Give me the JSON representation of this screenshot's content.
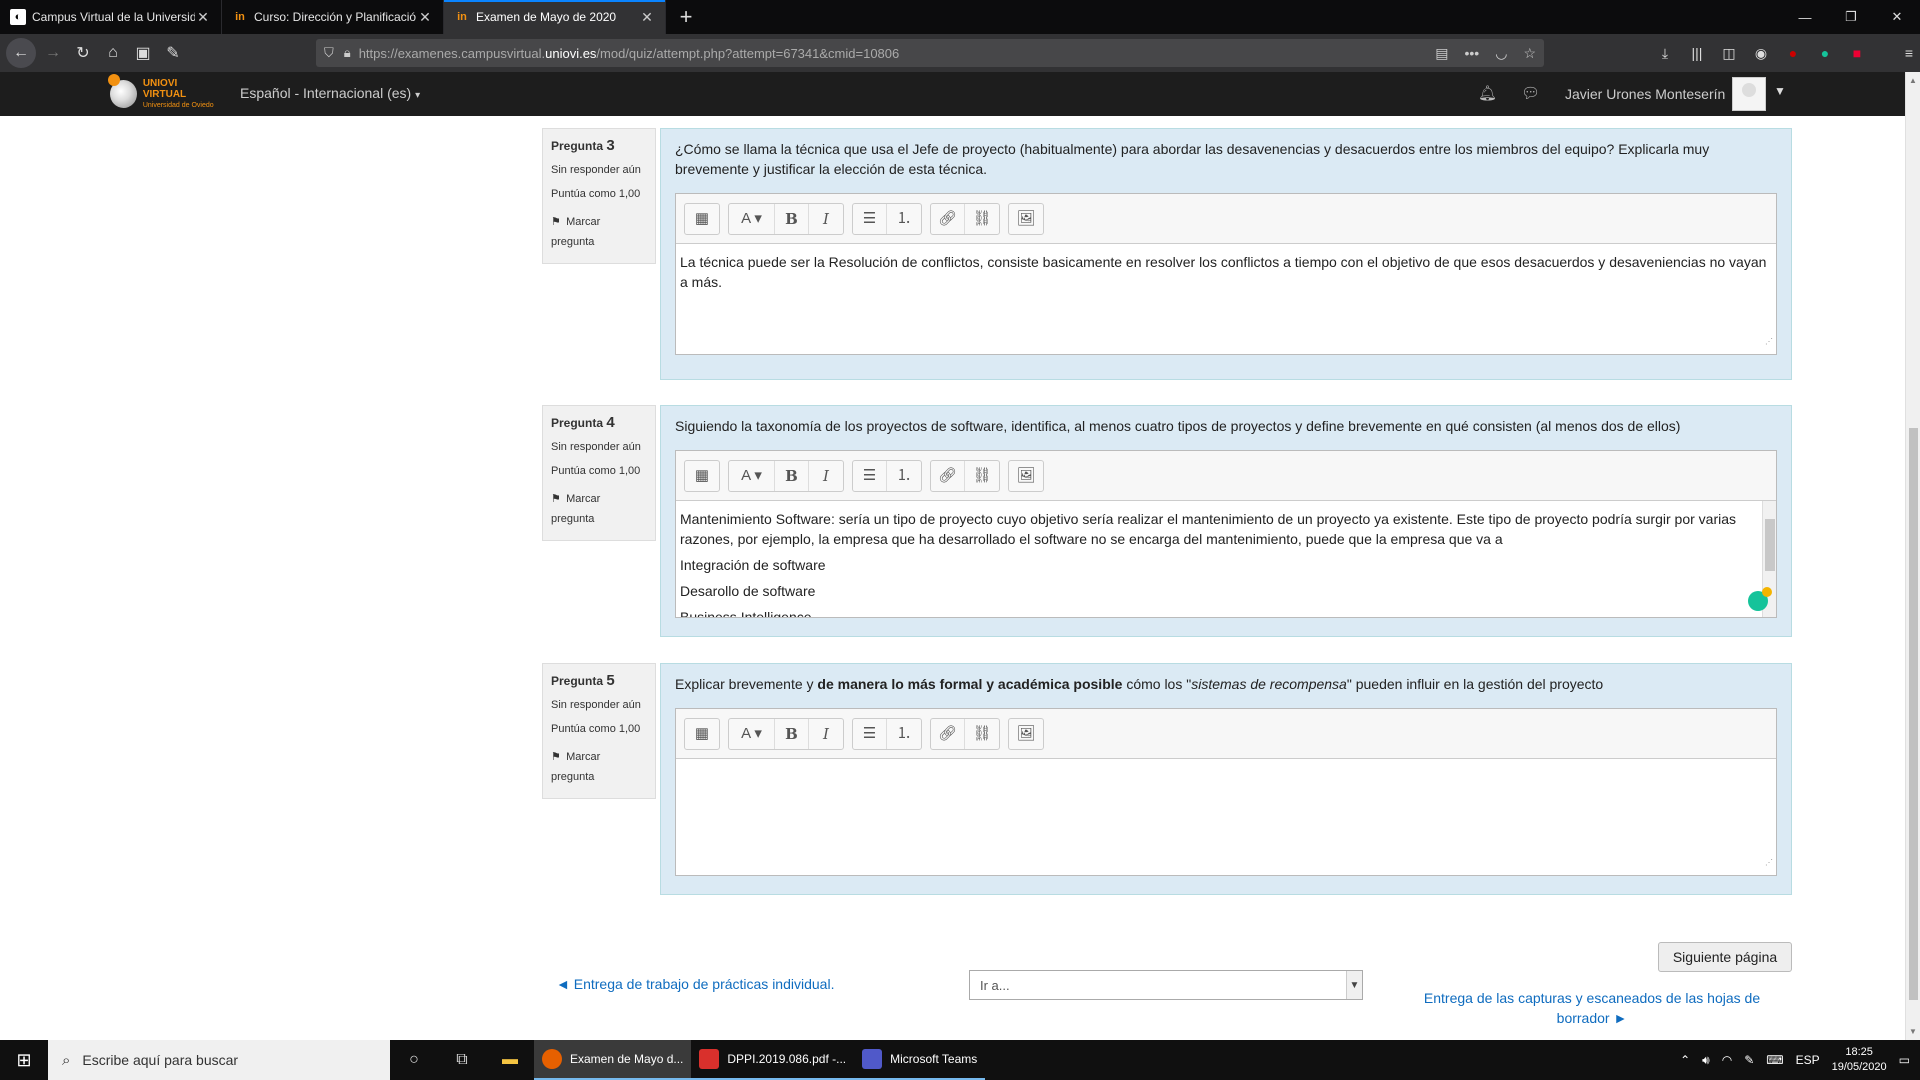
{
  "browser": {
    "tabs": [
      {
        "title": "Campus Virtual de la Universid...",
        "icon": "campus-icon"
      },
      {
        "title": "Curso: Dirección y Planificació...",
        "icon": "course-icon"
      },
      {
        "title": "Examen de Mayo de 2020",
        "icon": "exam-icon"
      }
    ],
    "url_prefix": "https://examenes.campusvirtual.",
    "url_domain": "uniovi.es",
    "url_suffix": "/mod/quiz/attempt.php?attempt=67341&cmid=10806"
  },
  "header": {
    "logo_text": "UNIOVI VIRTUAL",
    "logo_sub": "Universidad de Oviedo",
    "language": "Español - Internacional (es)",
    "user_name": "Javier Urones Monteserín"
  },
  "questions": [
    {
      "label": "Pregunta",
      "number": "3",
      "status": "Sin responder aún",
      "score": "Puntúa como 1,00",
      "flag1": "Marcar",
      "flag2": "pregunta",
      "text": "¿Cómo se llama la técnica que usa el Jefe de proyecto (habitualmente) para abordar las desavenencias y desacuerdos entre los miembros del equipo? Explicarla muy brevemente y justificar la elección de esta técnica.",
      "answer": [
        "La técnica puede ser la Resolución de conflictos, consiste basicamente en resolver los conflictos a tiempo con el objetivo de que esos desacuerdos y desaveniencias no vayan a más."
      ]
    },
    {
      "label": "Pregunta",
      "number": "4",
      "status": "Sin responder aún",
      "score": "Puntúa como 1,00",
      "flag1": "Marcar",
      "flag2": "pregunta",
      "text": "Siguiendo la taxonomía de los proyectos de software, identifica, al menos cuatro tipos de proyectos y define brevemente en qué consisten (al menos dos de ellos)",
      "answer": [
        "Mantenimiento Software: sería un tipo de proyecto cuyo objetivo sería realizar el mantenimiento de un proyecto ya existente. Este tipo de proyecto podría surgir por varias razones, por ejemplo, la empresa que ha desarrollado el software no se encarga del mantenimiento, puede que la empresa que va a",
        "Integración de software",
        "Desarollo de software",
        "Business Intelligence"
      ]
    },
    {
      "label": "Pregunta",
      "number": "5",
      "status": "Sin responder aún",
      "score": "Puntúa como 1,00",
      "flag1": "Marcar",
      "flag2": "pregunta",
      "text_a": "Explicar brevemente y ",
      "text_b": "de manera lo más formal y académica posible",
      "text_c": " cómo los \"",
      "text_d": "sistemas de recompensa",
      "text_e": "\" pueden influir en la gestión del proyecto",
      "answer": []
    }
  ],
  "navigation": {
    "next_page": "Siguiente página",
    "prev_link": "◄ Entrega de trabajo de prácticas individual.",
    "jump_placeholder": "Ir a...",
    "next_link": "Entrega de las capturas y escaneados de las hojas de borrador ►"
  },
  "taskbar": {
    "search_placeholder": "Escribe aquí para buscar",
    "apps": [
      {
        "label": "Examen de Mayo d...",
        "icon": "firefox-icon"
      },
      {
        "label": "DPPI.2019.086.pdf -...",
        "icon": "pdf-icon"
      },
      {
        "label": "Microsoft Teams",
        "icon": "teams-icon"
      }
    ],
    "lang": "ESP",
    "time": "18:25",
    "date": "19/05/2020"
  },
  "colors": {
    "question_bg": "#dbeaf4",
    "link": "#0f6cbf",
    "brand_orange": "#f29111"
  }
}
